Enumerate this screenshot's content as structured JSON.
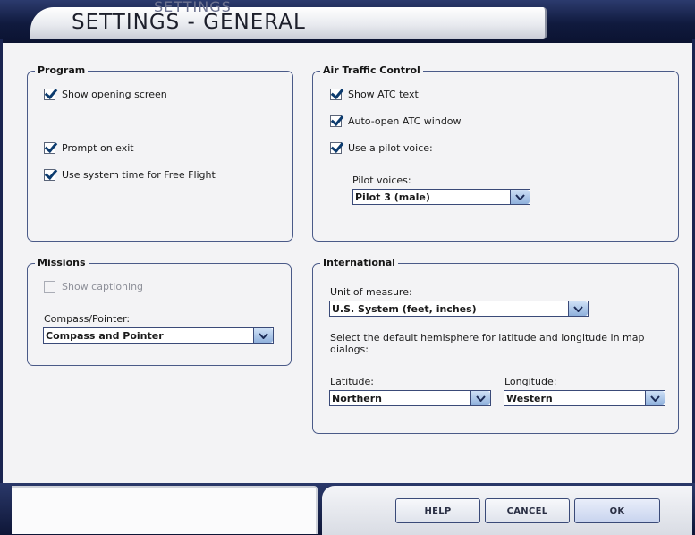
{
  "header": {
    "title": "SETTINGS - GENERAL",
    "ghost_text": "SETTINGS"
  },
  "program": {
    "title": "Program",
    "show_opening_screen": "Show opening screen",
    "prompt_on_exit": "Prompt on exit",
    "use_system_time": "Use system time for Free Flight"
  },
  "missions": {
    "title": "Missions",
    "show_captioning": "Show captioning",
    "compass_label": "Compass/Pointer:",
    "compass_value": "Compass and Pointer"
  },
  "atc": {
    "title": "Air Traffic Control",
    "show_atc_text": "Show ATC text",
    "auto_open_window": "Auto-open ATC window",
    "use_pilot_voice": "Use a pilot voice:",
    "pilot_voices_label": "Pilot voices:",
    "pilot_voice_value": "Pilot 3 (male)"
  },
  "international": {
    "title": "International",
    "unit_label": "Unit of measure:",
    "unit_value": "U.S. System (feet, inches)",
    "hemisphere_desc": "Select the default hemisphere for latitude and longitude in map dialogs:",
    "latitude_label": "Latitude:",
    "latitude_value": "Northern",
    "longitude_label": "Longitude:",
    "longitude_value": "Western"
  },
  "footer": {
    "help": "HELP",
    "cancel": "CANCEL",
    "ok": "OK"
  },
  "colors": {
    "accent": "#1a2450",
    "border": "#4a5a88",
    "check": "#0c3b6e"
  }
}
